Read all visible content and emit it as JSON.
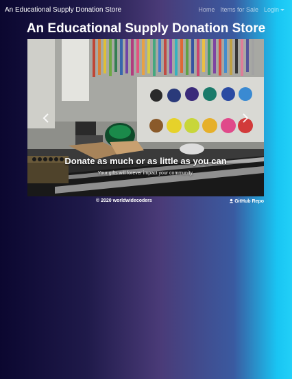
{
  "navbar": {
    "brand": "An Educational Supply Donation Store",
    "links": [
      "Home",
      "Items for Sale",
      "Login"
    ]
  },
  "page": {
    "title": "An Educational Supply Donation Store"
  },
  "carousel": {
    "caption_title": "Donate as much or as little as you can",
    "caption_text": "Your gifts will forever impact your community.",
    "prev_icon": "chevron-left-icon",
    "next_icon": "chevron-right-icon"
  },
  "footer": {
    "copyright": "© 2020 worldwidecoders",
    "repo_link": "GitHub Repo",
    "repo_icon": "github-icon"
  },
  "colors": {
    "gradient_start": "#0b0730",
    "gradient_end": "#22d0f8"
  }
}
